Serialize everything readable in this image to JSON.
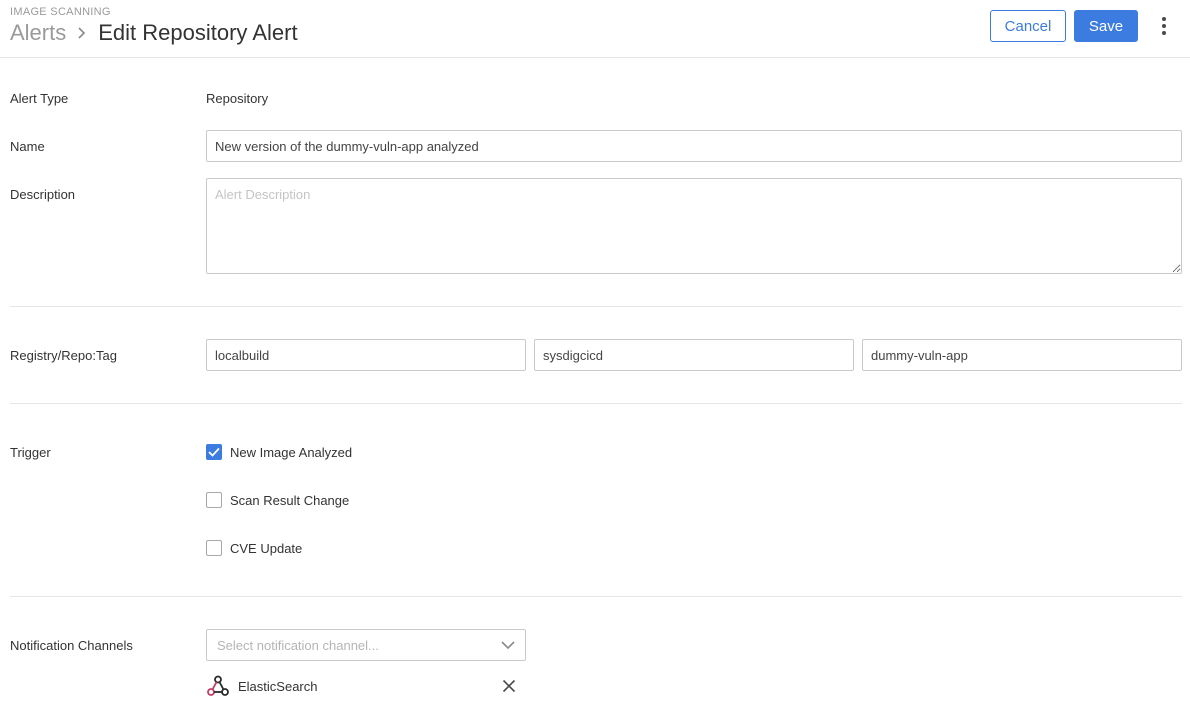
{
  "header": {
    "eyebrow": "IMAGE SCANNING",
    "breadcrumb_parent": "Alerts",
    "breadcrumb_current": "Edit Repository Alert",
    "cancel_label": "Cancel",
    "save_label": "Save"
  },
  "form": {
    "alert_type": {
      "label": "Alert Type",
      "value": "Repository"
    },
    "name": {
      "label": "Name",
      "value": "New version of the dummy-vuln-app analyzed"
    },
    "description": {
      "label": "Description",
      "placeholder": "Alert Description",
      "value": ""
    },
    "registry_repo_tag": {
      "label": "Registry/Repo:Tag",
      "registry": "localbuild",
      "repo": "sysdigcicd",
      "tag": "dummy-vuln-app"
    },
    "trigger": {
      "label": "Trigger",
      "options": [
        {
          "label": "New Image Analyzed",
          "checked": true
        },
        {
          "label": "Scan Result Change",
          "checked": false
        },
        {
          "label": "CVE Update",
          "checked": false
        }
      ]
    },
    "notification_channels": {
      "label": "Notification Channels",
      "placeholder": "Select notification channel...",
      "selected": [
        {
          "name": "ElasticSearch",
          "icon": "webhook-icon"
        }
      ]
    }
  },
  "colors": {
    "accent": "#3c7be0",
    "muted_text": "#9a9a9a",
    "border": "#c9c9c9",
    "divider": "#e6e6e6",
    "webhook_red": "#c73a63"
  }
}
